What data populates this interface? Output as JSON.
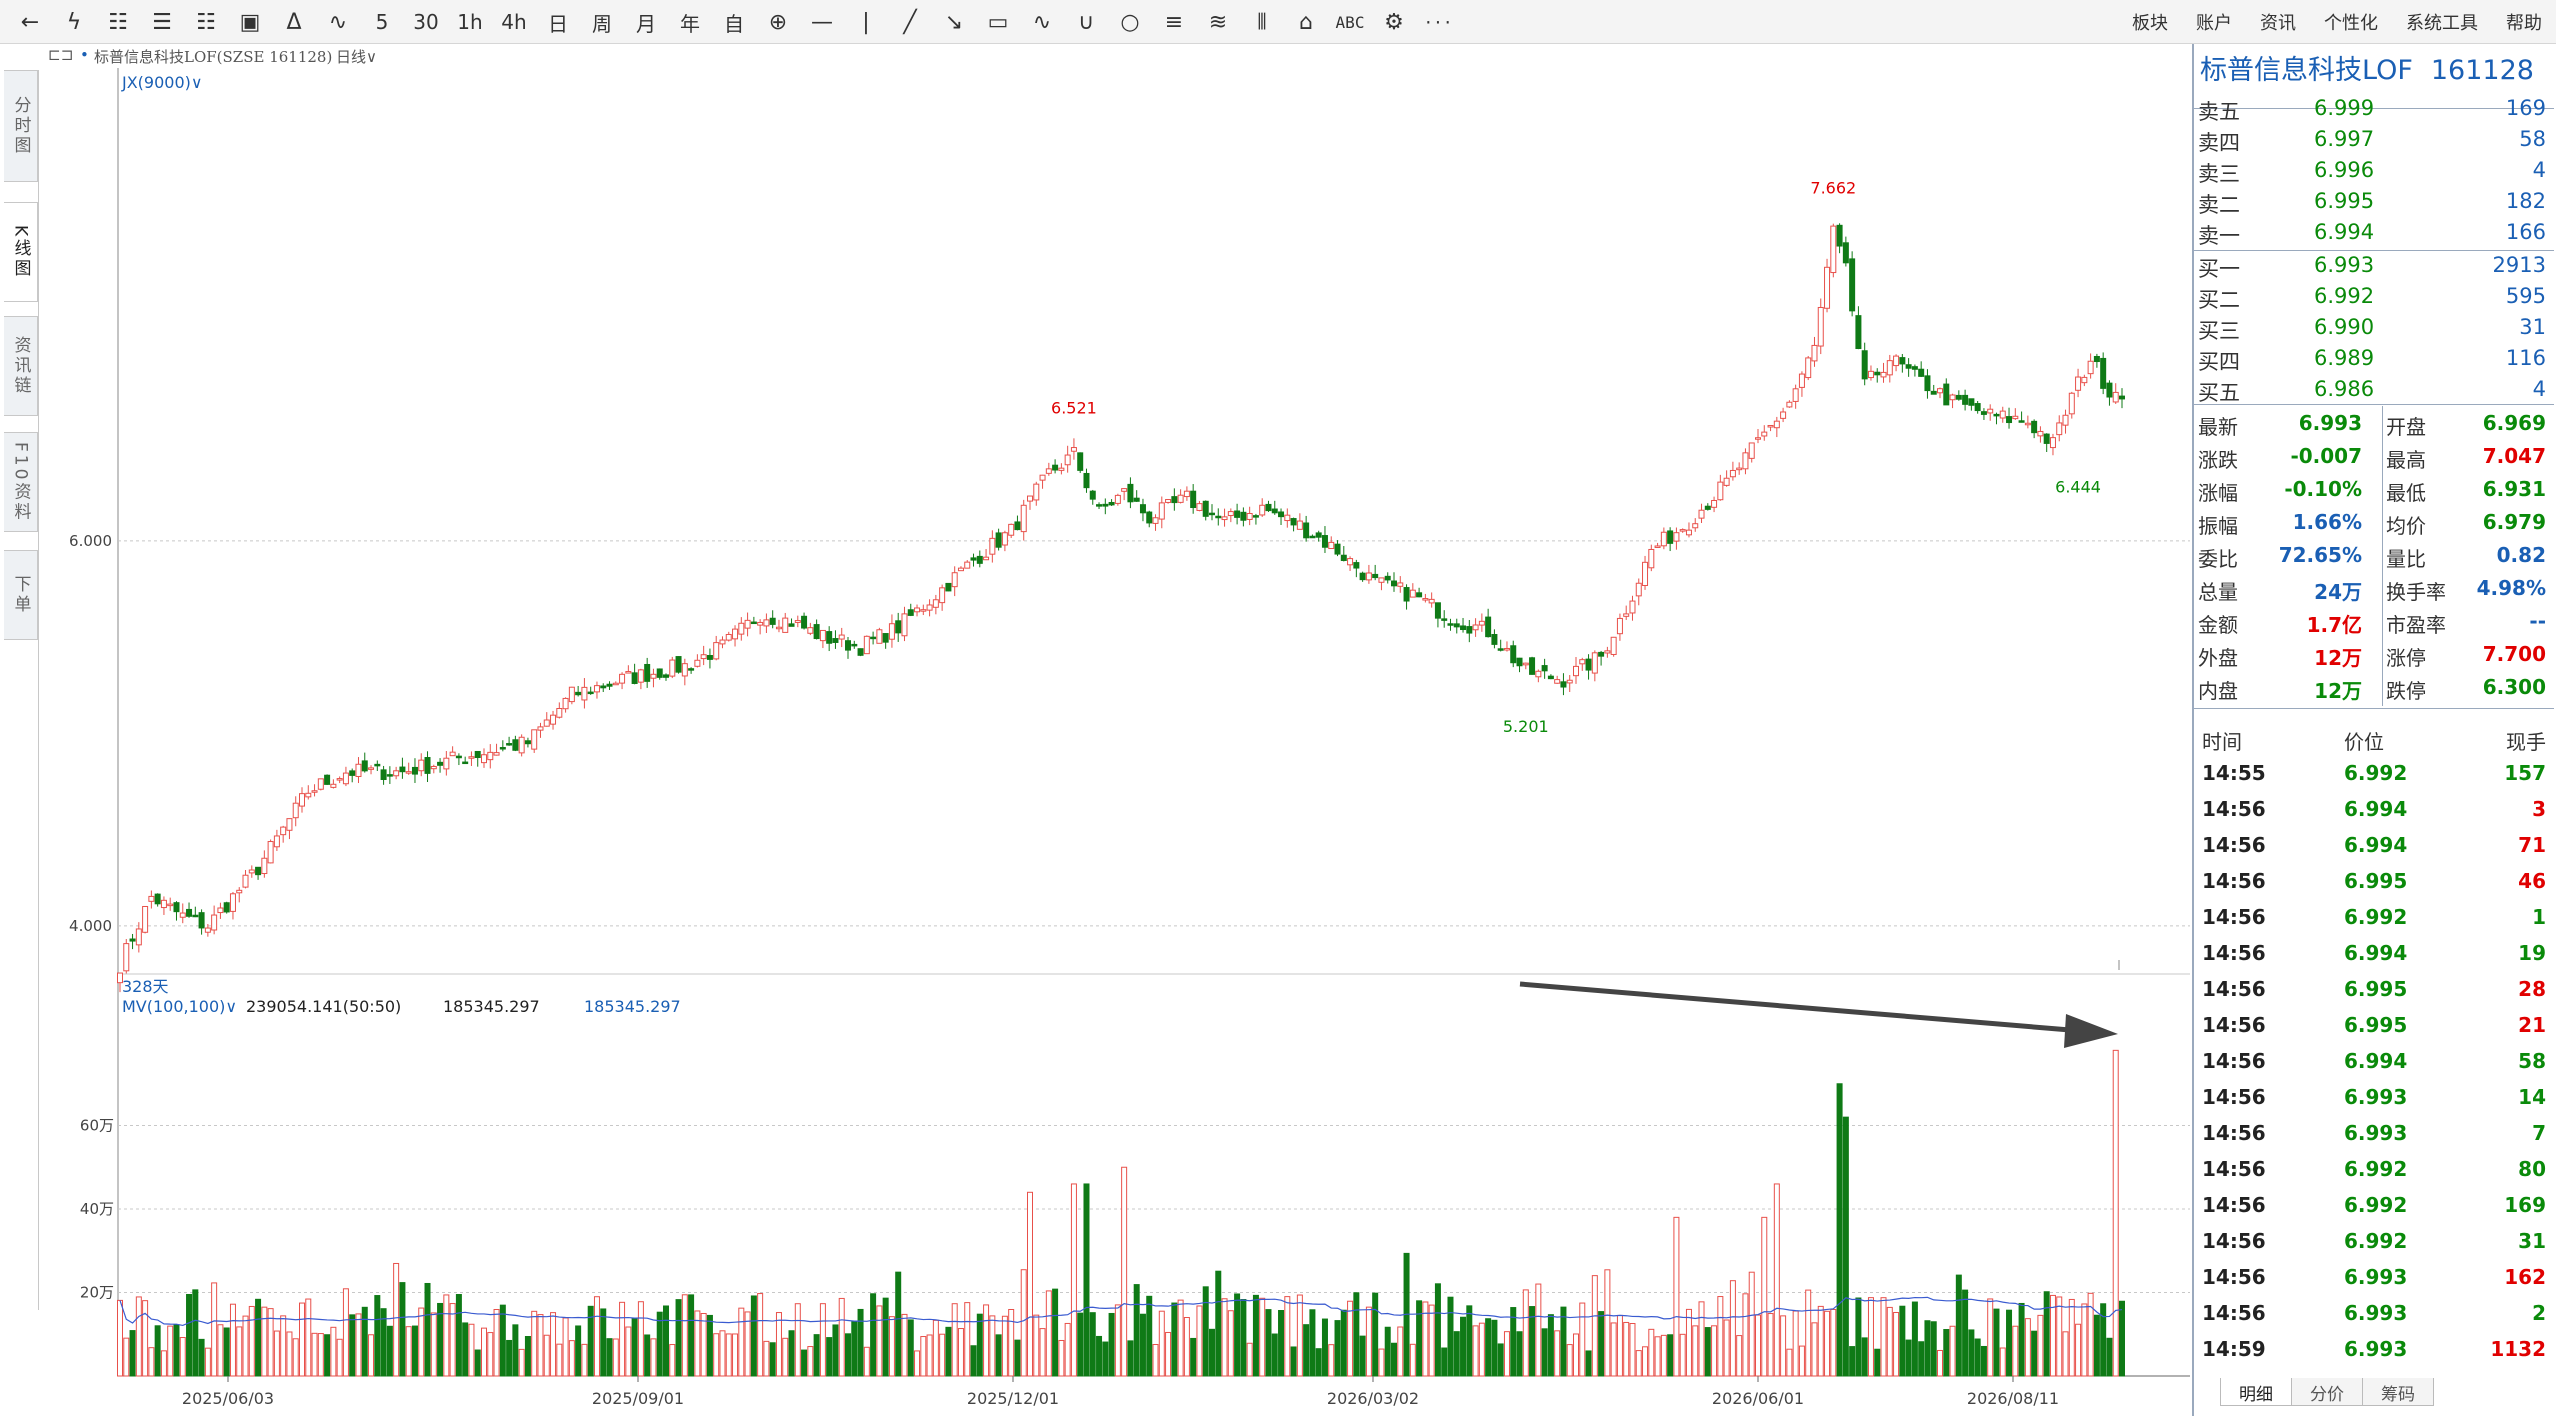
{
  "toolbar": {
    "icons": [
      {
        "name": "back-icon",
        "glyph": "←"
      },
      {
        "name": "lightning-icon",
        "glyph": "ϟ"
      },
      {
        "name": "draw-k-icon",
        "glyph": "☷"
      },
      {
        "name": "draw-fx-icon",
        "glyph": "☰"
      },
      {
        "name": "grid-icon",
        "glyph": "☷"
      },
      {
        "name": "table-icon",
        "glyph": "▣"
      },
      {
        "name": "bell-icon",
        "glyph": "Δ"
      },
      {
        "name": "trend-icon",
        "glyph": "∿"
      }
    ],
    "period_labels": [
      "5",
      "30",
      "1h",
      "4h",
      "日",
      "周",
      "月",
      "年",
      "自"
    ],
    "draw_icons": [
      {
        "name": "crosshair-move-icon",
        "glyph": "⊕"
      },
      {
        "name": "hline-tool-icon",
        "glyph": "—"
      },
      {
        "name": "vline-tool-icon",
        "glyph": "|"
      },
      {
        "name": "segment-tool-icon",
        "glyph": "╱"
      },
      {
        "name": "arrow-tool-icon",
        "glyph": "↘"
      },
      {
        "name": "rect-tool-icon",
        "glyph": "▭"
      },
      {
        "name": "wave-tool-icon",
        "glyph": "∿"
      },
      {
        "name": "cup-tool-icon",
        "glyph": "∪"
      },
      {
        "name": "circle-tool-icon",
        "glyph": "○"
      },
      {
        "name": "fib-tool-icon",
        "glyph": "≡"
      },
      {
        "name": "channel-tool-icon",
        "glyph": "≋"
      },
      {
        "name": "bars-tool-icon",
        "glyph": "⦀"
      },
      {
        "name": "house-tool-icon",
        "glyph": "⌂"
      },
      {
        "name": "text-tool-icon",
        "glyph": "ABC"
      },
      {
        "name": "settings-tool-icon",
        "glyph": "⚙"
      },
      {
        "name": "more-icon",
        "glyph": "···"
      }
    ],
    "menu": [
      "板块",
      "账户",
      "资讯",
      "个性化",
      "系统工具",
      "帮助"
    ]
  },
  "infobar": {
    "instrument": "标普信息科技LOF(SZSE 161128)",
    "period": "日线∨"
  },
  "side_tabs": [
    {
      "label": "分时图",
      "active": false
    },
    {
      "label": "K线图",
      "active": true
    },
    {
      "label": "资讯链",
      "active": false
    },
    {
      "label": "F10资料",
      "active": false
    },
    {
      "label": "下单",
      "active": false
    }
  ],
  "chart": {
    "main_indicator": "JX(9000)∨",
    "vol_indicator": "MV(100,100)∨",
    "vol_val1": "239054.141(50:50)",
    "vol_val2": "185345.297",
    "vol_val3": "185345.297",
    "days_label": "328天",
    "colors": {
      "up": "#e8504a",
      "down": "#0f7a16",
      "ma": "#3a5bd0",
      "grid": "#c8c8c8"
    }
  },
  "chart_data": {
    "type": "candlestick",
    "price_ticks": [
      "4.000",
      "6.000"
    ],
    "volume_ticks": [
      "20万",
      "40万",
      "60万"
    ],
    "dates": [
      "2025/06/03",
      "2025/09/01",
      "2025/12/01",
      "2026/03/02",
      "2026/06/01",
      "2026/08/11"
    ],
    "annotations": [
      {
        "label": "6.521",
        "type": "high"
      },
      {
        "label": "7.662",
        "type": "high"
      },
      {
        "label": "5.201",
        "type": "low"
      },
      {
        "label": "6.444",
        "type": "low"
      }
    ],
    "price_range": [
      3.75,
      8.3
    ],
    "volume_range": [
      0,
      80
    ],
    "closes_anchor": [
      [
        0,
        3.8
      ],
      [
        5,
        4.15
      ],
      [
        10,
        4.05
      ],
      [
        14,
        4.0
      ],
      [
        22,
        4.3
      ],
      [
        30,
        4.7
      ],
      [
        36,
        4.8
      ],
      [
        45,
        4.8
      ],
      [
        55,
        4.88
      ],
      [
        65,
        4.95
      ],
      [
        72,
        5.2
      ],
      [
        80,
        5.28
      ],
      [
        90,
        5.35
      ],
      [
        96,
        5.45
      ],
      [
        102,
        5.62
      ],
      [
        107,
        5.58
      ],
      [
        112,
        5.5
      ],
      [
        118,
        5.45
      ],
      [
        124,
        5.55
      ],
      [
        130,
        5.72
      ],
      [
        136,
        5.9
      ],
      [
        142,
        6.05
      ],
      [
        148,
        6.35
      ],
      [
        152,
        6.45
      ],
      [
        156,
        6.15
      ],
      [
        160,
        6.25
      ],
      [
        164,
        6.12
      ],
      [
        170,
        6.22
      ],
      [
        176,
        6.1
      ],
      [
        182,
        6.17
      ],
      [
        188,
        6.08
      ],
      [
        194,
        5.95
      ],
      [
        200,
        5.78
      ],
      [
        206,
        5.72
      ],
      [
        212,
        5.6
      ],
      [
        218,
        5.53
      ],
      [
        224,
        5.32
      ],
      [
        230,
        5.28
      ],
      [
        236,
        5.4
      ],
      [
        240,
        5.65
      ],
      [
        244,
        5.95
      ],
      [
        250,
        6.1
      ],
      [
        256,
        6.3
      ],
      [
        262,
        6.55
      ],
      [
        266,
        6.72
      ],
      [
        270,
        7.0
      ],
      [
        273,
        7.6
      ],
      [
        275,
        7.4
      ],
      [
        278,
        6.8
      ],
      [
        282,
        6.95
      ],
      [
        286,
        6.85
      ],
      [
        292,
        6.72
      ],
      [
        298,
        6.65
      ],
      [
        304,
        6.62
      ],
      [
        308,
        6.5
      ],
      [
        311,
        6.75
      ],
      [
        314,
        6.95
      ],
      [
        317,
        6.78
      ]
    ],
    "volume_spikes": [
      {
        "i": 274,
        "v": 70
      },
      {
        "i": 275,
        "v": 62
      },
      {
        "i": 264,
        "v": 46
      },
      {
        "i": 318,
        "v": 78
      },
      {
        "i": 152,
        "v": 46
      },
      {
        "i": 154,
        "v": 46
      },
      {
        "i": 160,
        "v": 50
      },
      {
        "i": 145,
        "v": 44
      },
      {
        "i": 248,
        "v": 38
      },
      {
        "i": 262,
        "v": 38
      }
    ]
  },
  "annotation_arrow": {
    "color": "#444444"
  },
  "panel": {
    "title_name": "标普信息科技LOF",
    "title_code": "161128",
    "asks": [
      {
        "label": "卖五",
        "price": "6.999",
        "vol": "169"
      },
      {
        "label": "卖四",
        "price": "6.997",
        "vol": "58"
      },
      {
        "label": "卖三",
        "price": "6.996",
        "vol": "4"
      },
      {
        "label": "卖二",
        "price": "6.995",
        "vol": "182"
      },
      {
        "label": "卖一",
        "price": "6.994",
        "vol": "166"
      }
    ],
    "bids": [
      {
        "label": "买一",
        "price": "6.993",
        "vol": "2913"
      },
      {
        "label": "买二",
        "price": "6.992",
        "vol": "595"
      },
      {
        "label": "买三",
        "price": "6.990",
        "vol": "31"
      },
      {
        "label": "买四",
        "price": "6.989",
        "vol": "116"
      },
      {
        "label": "买五",
        "price": "6.986",
        "vol": "4"
      }
    ],
    "stats": [
      {
        "k1": "最新",
        "v1": "6.993",
        "c1": "green",
        "k2": "开盘",
        "v2": "6.969",
        "c2": "green"
      },
      {
        "k1": "涨跌",
        "v1": "-0.007",
        "c1": "green",
        "k2": "最高",
        "v2": "7.047",
        "c2": "red"
      },
      {
        "k1": "涨幅",
        "v1": "-0.10%",
        "c1": "green",
        "k2": "最低",
        "v2": "6.931",
        "c2": "green"
      },
      {
        "k1": "振幅",
        "v1": "1.66%",
        "c1": "blue",
        "k2": "均价",
        "v2": "6.979",
        "c2": "green"
      },
      {
        "k1": "委比",
        "v1": "72.65%",
        "c1": "blue",
        "k2": "量比",
        "v2": "0.82",
        "c2": "blue"
      },
      {
        "k1": "总量",
        "v1": "24万",
        "c1": "blue",
        "k2": "换手率",
        "v2": "4.98%",
        "c2": "blue"
      },
      {
        "k1": "金额",
        "v1": "1.7亿",
        "c1": "red",
        "k2": "市盈率",
        "v2": "--",
        "c2": "blue"
      },
      {
        "k1": "外盘",
        "v1": "12万",
        "c1": "red",
        "k2": "涨停",
        "v2": "7.700",
        "c2": "red"
      },
      {
        "k1": "内盘",
        "v1": "12万",
        "c1": "green",
        "k2": "跌停",
        "v2": "6.300",
        "c2": "green"
      }
    ],
    "tick_header": {
      "time": "时间",
      "price": "价位",
      "qty": "现手"
    },
    "ticks": [
      {
        "time": "14:55",
        "price": "6.992",
        "qty": "157",
        "c": "green"
      },
      {
        "time": "14:56",
        "price": "6.994",
        "qty": "3",
        "c": "red"
      },
      {
        "time": "14:56",
        "price": "6.994",
        "qty": "71",
        "c": "red"
      },
      {
        "time": "14:56",
        "price": "6.995",
        "qty": "46",
        "c": "red"
      },
      {
        "time": "14:56",
        "price": "6.992",
        "qty": "1",
        "c": "green"
      },
      {
        "time": "14:56",
        "price": "6.994",
        "qty": "19",
        "c": "green"
      },
      {
        "time": "14:56",
        "price": "6.995",
        "qty": "28",
        "c": "red"
      },
      {
        "time": "14:56",
        "price": "6.995",
        "qty": "21",
        "c": "red"
      },
      {
        "time": "14:56",
        "price": "6.994",
        "qty": "58",
        "c": "green"
      },
      {
        "time": "14:56",
        "price": "6.993",
        "qty": "14",
        "c": "green"
      },
      {
        "time": "14:56",
        "price": "6.993",
        "qty": "7",
        "c": "green"
      },
      {
        "time": "14:56",
        "price": "6.992",
        "qty": "80",
        "c": "green"
      },
      {
        "time": "14:56",
        "price": "6.992",
        "qty": "169",
        "c": "green"
      },
      {
        "time": "14:56",
        "price": "6.992",
        "qty": "31",
        "c": "green"
      },
      {
        "time": "14:56",
        "price": "6.993",
        "qty": "162",
        "c": "red"
      },
      {
        "time": "14:56",
        "price": "6.993",
        "qty": "2",
        "c": "green"
      },
      {
        "time": "14:59",
        "price": "6.993",
        "qty": "1132",
        "c": "red"
      }
    ],
    "bottom_tabs": [
      "明细",
      "分价",
      "筹码"
    ]
  }
}
